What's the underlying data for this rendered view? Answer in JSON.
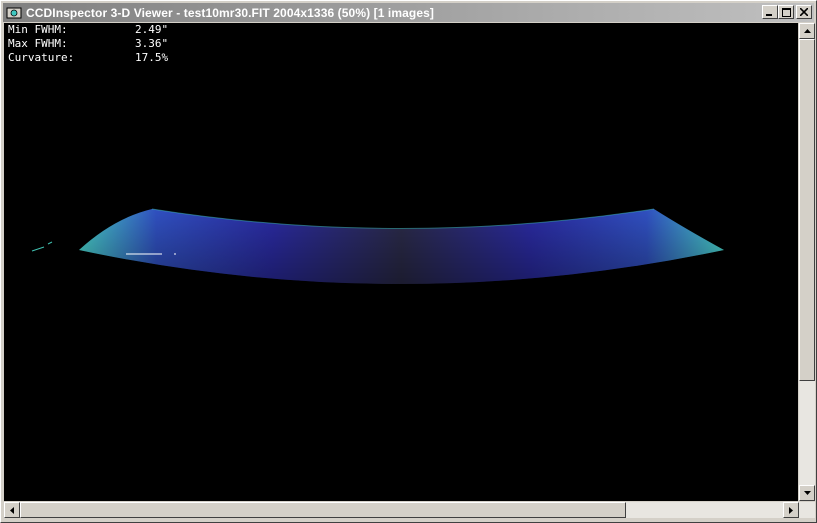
{
  "window": {
    "title": "CCDInspector 3-D Viewer - test10mr30.FIT 2004x1336 (50%)  [1 images]"
  },
  "stats": {
    "min_fwhm_label": "Min FWHM:",
    "min_fwhm_value": "2.49\"",
    "max_fwhm_label": "Max FWHM:",
    "max_fwhm_value": "3.36\"",
    "curvature_label": "Curvature:",
    "curvature_value": "17.5%"
  },
  "icons": {
    "app": "app-icon",
    "minimize": "minimize-icon",
    "maximize": "maximize-icon",
    "close": "close-icon",
    "scroll_up": "arrow-up-icon",
    "scroll_down": "arrow-down-icon",
    "scroll_left": "arrow-left-icon",
    "scroll_right": "arrow-right-icon"
  },
  "colors": {
    "surface_edge": "#40c8c0",
    "surface_mid": "#2a2a9a",
    "surface_center": "#2a2a3a"
  }
}
